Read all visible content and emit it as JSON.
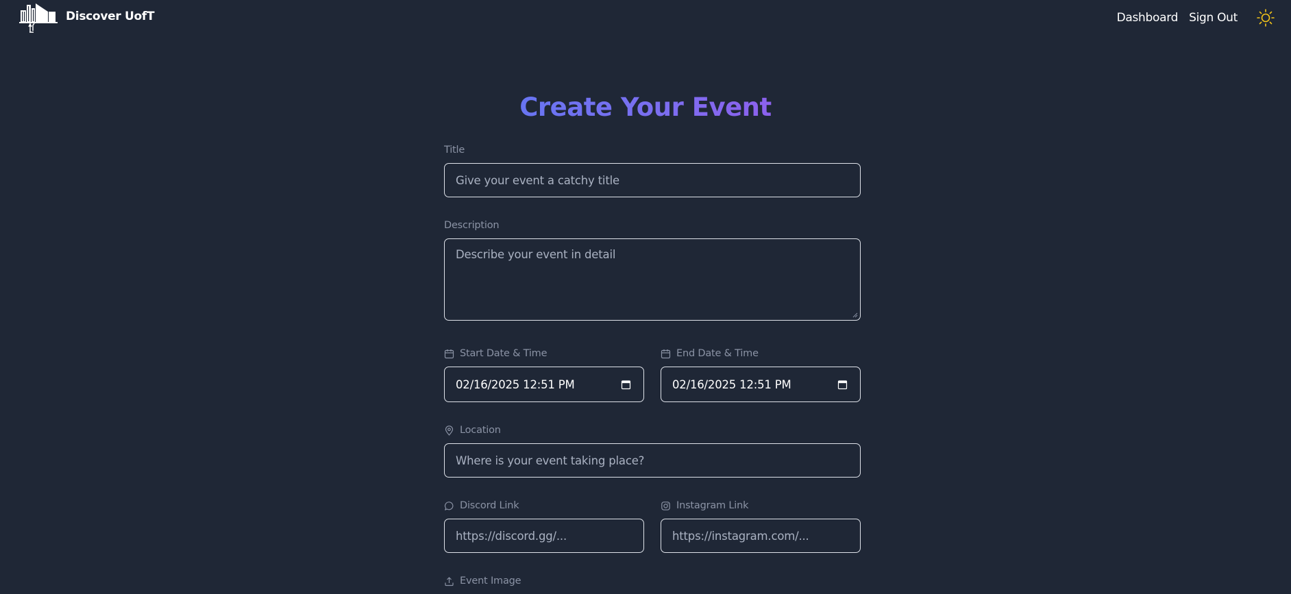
{
  "header": {
    "brand_name": "Discover UofT",
    "nav": {
      "dashboard": "Dashboard",
      "sign_out": "Sign Out"
    },
    "theme_icon": "sun-icon",
    "theme_icon_color": "#f5c518"
  },
  "form": {
    "title": "Create Your Event",
    "title_gradient": [
      "#6875f2",
      "#8c61ee"
    ],
    "fields": {
      "title": {
        "label": "Title",
        "placeholder": "Give your event a catchy title"
      },
      "description": {
        "label": "Description",
        "placeholder": "Describe your event in detail"
      },
      "start": {
        "label": "Start Date & Time",
        "icon": "calendar-icon",
        "value": "02/16/2025 12:51 PM"
      },
      "end": {
        "label": "End Date & Time",
        "icon": "calendar-icon",
        "value": "02/16/2025 12:51 PM"
      },
      "location": {
        "label": "Location",
        "icon": "map-pin-icon",
        "placeholder": "Where is your event taking place?"
      },
      "discord": {
        "label": "Discord Link",
        "icon": "chat-bubble-icon",
        "placeholder": "https://discord.gg/..."
      },
      "instagram": {
        "label": "Instagram Link",
        "icon": "instagram-icon",
        "placeholder": "https://instagram.com/..."
      },
      "image": {
        "label": "Event Image",
        "icon": "upload-icon"
      }
    }
  },
  "colors": {
    "background": "#1f2736",
    "input_border": "#dfe3ea",
    "label": "#8b93a5",
    "placeholder": "#aab2c2"
  }
}
